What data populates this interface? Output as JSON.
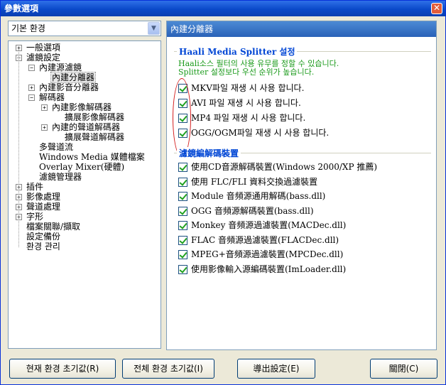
{
  "window": {
    "title": "參數選項",
    "close_glyph": "✕"
  },
  "profile_select": {
    "value": "기본 환경",
    "arrow_glyph": "▼"
  },
  "tree": {
    "expander_plus": "+",
    "expander_minus": "−",
    "items": [
      {
        "label": "一般選項",
        "expander": "plus"
      },
      {
        "label": "濾鏡設定",
        "expander": "minus"
      },
      {
        "label": "內建源濾鏡",
        "expander": "minus"
      },
      {
        "label": "內建分離器",
        "expander": "none",
        "selected": true
      },
      {
        "label": "內建影音分離器",
        "expander": "plus"
      },
      {
        "label": "解碼器",
        "expander": "minus"
      },
      {
        "label": "內建影像解碼器",
        "expander": "plus"
      },
      {
        "label": "擴展影像解碼器",
        "expander": "none"
      },
      {
        "label": "內建的聲道解碼器",
        "expander": "plus"
      },
      {
        "label": "擴展聲道解碼器",
        "expander": "none"
      },
      {
        "label": "多聲道流",
        "expander": "none"
      },
      {
        "label": "Windows Media 媒體檔案",
        "expander": "none"
      },
      {
        "label": "Overlay Mixer(硬體)",
        "expander": "none"
      },
      {
        "label": "濾鏡管理器",
        "expander": "none"
      },
      {
        "label": "插件",
        "expander": "plus"
      },
      {
        "label": "影像處理",
        "expander": "plus"
      },
      {
        "label": "聲道處理",
        "expander": "plus"
      },
      {
        "label": "字形",
        "expander": "plus"
      },
      {
        "label": "檔案關聯/擷取",
        "expander": "none"
      },
      {
        "label": "設定備份",
        "expander": "none"
      },
      {
        "label": "환경 관리",
        "expander": "none"
      }
    ]
  },
  "panel": {
    "header": "內建分離器",
    "haali_group": {
      "title": "Haali Media Splitter 설정",
      "desc_line1": "Haali소스 필터의 사용 유무를 정할 수 있습니다.",
      "desc_line2": "Splitter 설정보다 우선 순위가 높습니다.",
      "options": [
        {
          "label": "MKV파일 재생 시 사용 합니다.",
          "checked": true
        },
        {
          "label": "AVI 파일 재생 시 사용 합니다.",
          "checked": true
        },
        {
          "label": "MP4 파일 재생 시 사용 합니다.",
          "checked": true
        },
        {
          "label": "OGG/OGM파일 재생 시 사용 합니다.",
          "checked": true
        }
      ]
    },
    "source_group": {
      "title": "濾鏡編解碼裝置",
      "options": [
        {
          "label": "使用CD音源解碼裝置(Windows 2000/XP 推薦)",
          "checked": true
        },
        {
          "label": "使用 FLC/FLI 資料交換過濾裝置",
          "checked": true
        },
        {
          "label": "Module 音頻源通用解碼(bass.dll)",
          "checked": true
        },
        {
          "label": "OGG 音頻源解碼裝置(bass.dll)",
          "checked": true
        },
        {
          "label": "Monkey 音頻源過濾裝置(MACDec.dll)",
          "checked": true
        },
        {
          "label": "FLAC 音頻源過濾裝置(FLACDec.dll)",
          "checked": true
        },
        {
          "label": "MPEG+音頻源過濾裝置(MPCDec.dll)",
          "checked": true
        },
        {
          "label": "使用影像輸入源編碼裝置(ImLoader.dll)",
          "checked": true
        }
      ]
    }
  },
  "buttons": {
    "reset_current": "현재 환경 초기값(R)",
    "reset_all": "전체 환경 초기값(I)",
    "export": "導出設定(E)",
    "close": "關閉(C)"
  },
  "colors": {
    "title_bar": "#0a49c9",
    "group_title": "#0046d5",
    "description": "#1a9a1a",
    "annotation_oval": "#d31c1c"
  }
}
